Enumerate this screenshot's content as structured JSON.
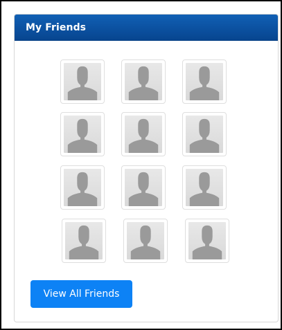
{
  "widget": {
    "title": "My Friends",
    "friends": [
      {
        "avatar": "default-user-silhouette"
      },
      {
        "avatar": "default-user-silhouette"
      },
      {
        "avatar": "default-user-silhouette"
      },
      {
        "avatar": "default-user-silhouette"
      },
      {
        "avatar": "default-user-silhouette"
      },
      {
        "avatar": "default-user-silhouette"
      },
      {
        "avatar": "default-user-silhouette"
      },
      {
        "avatar": "default-user-silhouette"
      },
      {
        "avatar": "default-user-silhouette"
      },
      {
        "avatar": "default-user-silhouette"
      },
      {
        "avatar": "default-user-silhouette"
      },
      {
        "avatar": "default-user-silhouette"
      }
    ],
    "view_all_label": "View All Friends"
  },
  "colors": {
    "header": "#0b56a8",
    "button": "#0d82f5",
    "silhouette": "#9a9a9a"
  }
}
